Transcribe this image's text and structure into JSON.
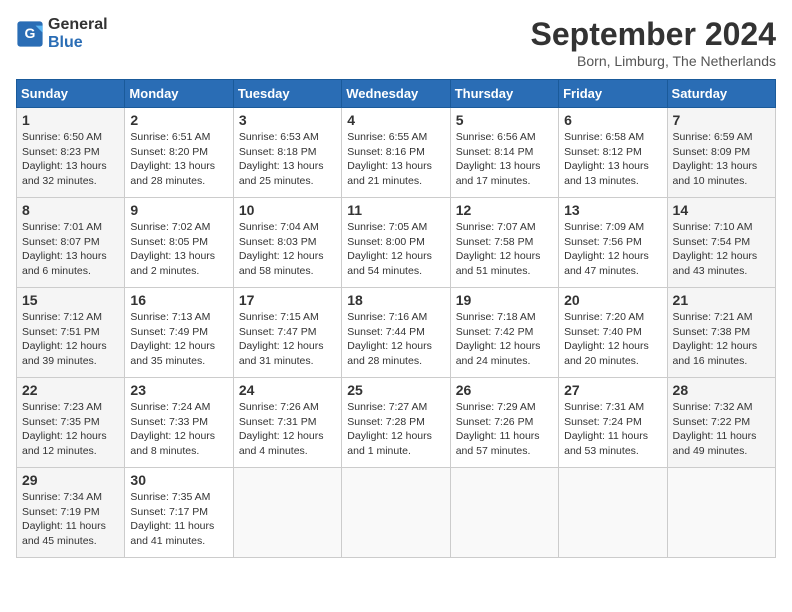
{
  "header": {
    "logo_line1": "General",
    "logo_line2": "Blue",
    "month": "September 2024",
    "location": "Born, Limburg, The Netherlands"
  },
  "days_of_week": [
    "Sunday",
    "Monday",
    "Tuesday",
    "Wednesday",
    "Thursday",
    "Friday",
    "Saturday"
  ],
  "weeks": [
    [
      {
        "day": "1",
        "info": "Sunrise: 6:50 AM\nSunset: 8:23 PM\nDaylight: 13 hours and 32 minutes."
      },
      {
        "day": "2",
        "info": "Sunrise: 6:51 AM\nSunset: 8:20 PM\nDaylight: 13 hours and 28 minutes."
      },
      {
        "day": "3",
        "info": "Sunrise: 6:53 AM\nSunset: 8:18 PM\nDaylight: 13 hours and 25 minutes."
      },
      {
        "day": "4",
        "info": "Sunrise: 6:55 AM\nSunset: 8:16 PM\nDaylight: 13 hours and 21 minutes."
      },
      {
        "day": "5",
        "info": "Sunrise: 6:56 AM\nSunset: 8:14 PM\nDaylight: 13 hours and 17 minutes."
      },
      {
        "day": "6",
        "info": "Sunrise: 6:58 AM\nSunset: 8:12 PM\nDaylight: 13 hours and 13 minutes."
      },
      {
        "day": "7",
        "info": "Sunrise: 6:59 AM\nSunset: 8:09 PM\nDaylight: 13 hours and 10 minutes."
      }
    ],
    [
      {
        "day": "8",
        "info": "Sunrise: 7:01 AM\nSunset: 8:07 PM\nDaylight: 13 hours and 6 minutes."
      },
      {
        "day": "9",
        "info": "Sunrise: 7:02 AM\nSunset: 8:05 PM\nDaylight: 13 hours and 2 minutes."
      },
      {
        "day": "10",
        "info": "Sunrise: 7:04 AM\nSunset: 8:03 PM\nDaylight: 12 hours and 58 minutes."
      },
      {
        "day": "11",
        "info": "Sunrise: 7:05 AM\nSunset: 8:00 PM\nDaylight: 12 hours and 54 minutes."
      },
      {
        "day": "12",
        "info": "Sunrise: 7:07 AM\nSunset: 7:58 PM\nDaylight: 12 hours and 51 minutes."
      },
      {
        "day": "13",
        "info": "Sunrise: 7:09 AM\nSunset: 7:56 PM\nDaylight: 12 hours and 47 minutes."
      },
      {
        "day": "14",
        "info": "Sunrise: 7:10 AM\nSunset: 7:54 PM\nDaylight: 12 hours and 43 minutes."
      }
    ],
    [
      {
        "day": "15",
        "info": "Sunrise: 7:12 AM\nSunset: 7:51 PM\nDaylight: 12 hours and 39 minutes."
      },
      {
        "day": "16",
        "info": "Sunrise: 7:13 AM\nSunset: 7:49 PM\nDaylight: 12 hours and 35 minutes."
      },
      {
        "day": "17",
        "info": "Sunrise: 7:15 AM\nSunset: 7:47 PM\nDaylight: 12 hours and 31 minutes."
      },
      {
        "day": "18",
        "info": "Sunrise: 7:16 AM\nSunset: 7:44 PM\nDaylight: 12 hours and 28 minutes."
      },
      {
        "day": "19",
        "info": "Sunrise: 7:18 AM\nSunset: 7:42 PM\nDaylight: 12 hours and 24 minutes."
      },
      {
        "day": "20",
        "info": "Sunrise: 7:20 AM\nSunset: 7:40 PM\nDaylight: 12 hours and 20 minutes."
      },
      {
        "day": "21",
        "info": "Sunrise: 7:21 AM\nSunset: 7:38 PM\nDaylight: 12 hours and 16 minutes."
      }
    ],
    [
      {
        "day": "22",
        "info": "Sunrise: 7:23 AM\nSunset: 7:35 PM\nDaylight: 12 hours and 12 minutes."
      },
      {
        "day": "23",
        "info": "Sunrise: 7:24 AM\nSunset: 7:33 PM\nDaylight: 12 hours and 8 minutes."
      },
      {
        "day": "24",
        "info": "Sunrise: 7:26 AM\nSunset: 7:31 PM\nDaylight: 12 hours and 4 minutes."
      },
      {
        "day": "25",
        "info": "Sunrise: 7:27 AM\nSunset: 7:28 PM\nDaylight: 12 hours and 1 minute."
      },
      {
        "day": "26",
        "info": "Sunrise: 7:29 AM\nSunset: 7:26 PM\nDaylight: 11 hours and 57 minutes."
      },
      {
        "day": "27",
        "info": "Sunrise: 7:31 AM\nSunset: 7:24 PM\nDaylight: 11 hours and 53 minutes."
      },
      {
        "day": "28",
        "info": "Sunrise: 7:32 AM\nSunset: 7:22 PM\nDaylight: 11 hours and 49 minutes."
      }
    ],
    [
      {
        "day": "29",
        "info": "Sunrise: 7:34 AM\nSunset: 7:19 PM\nDaylight: 11 hours and 45 minutes."
      },
      {
        "day": "30",
        "info": "Sunrise: 7:35 AM\nSunset: 7:17 PM\nDaylight: 11 hours and 41 minutes."
      },
      {
        "day": "",
        "info": ""
      },
      {
        "day": "",
        "info": ""
      },
      {
        "day": "",
        "info": ""
      },
      {
        "day": "",
        "info": ""
      },
      {
        "day": "",
        "info": ""
      }
    ]
  ]
}
